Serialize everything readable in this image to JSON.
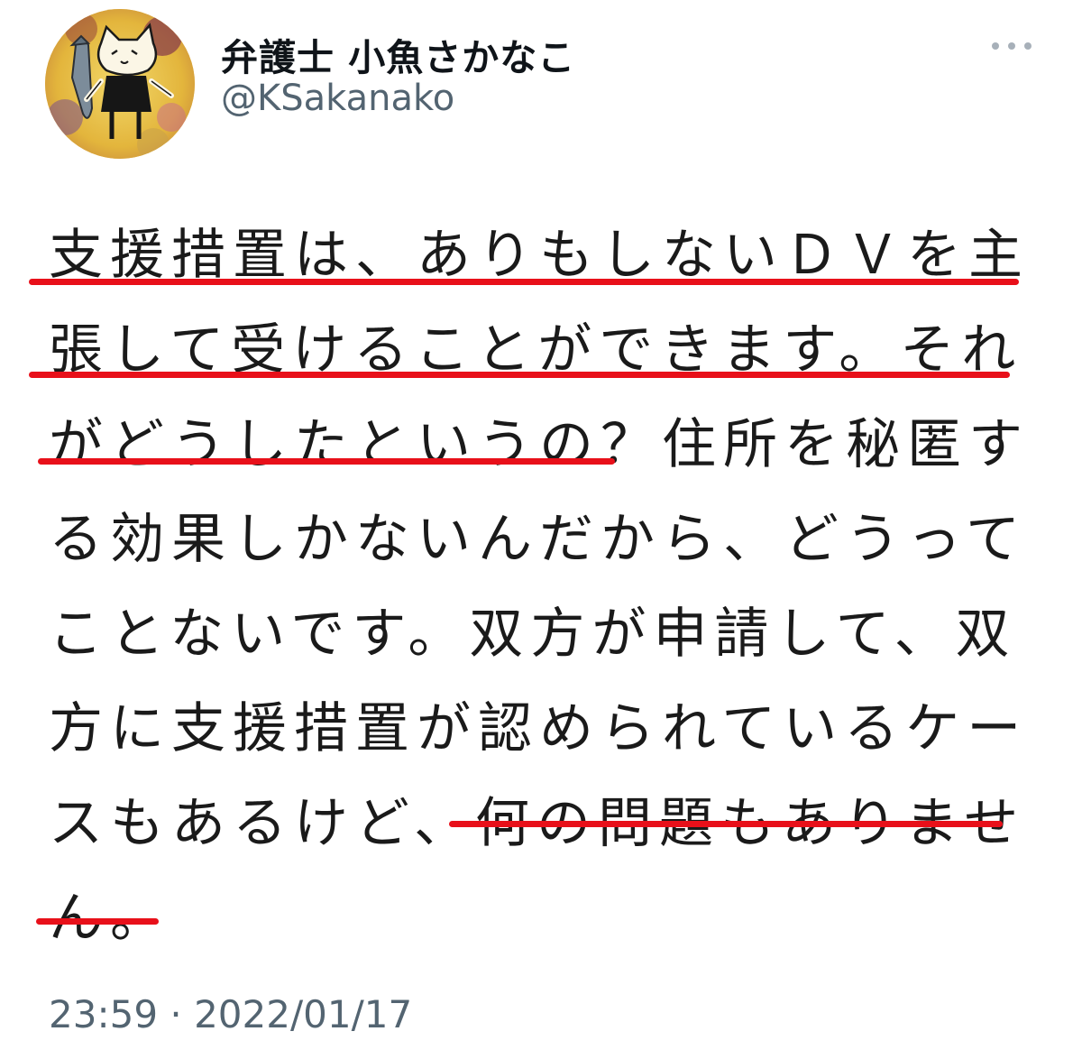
{
  "author": {
    "display_name": "弁護士 小魚さかなこ",
    "handle": "@KSakanako"
  },
  "tweet": {
    "lines": [
      "支援措置は、ありもしないＤＶを主",
      "張して受けることができます。それ",
      "がどうしたというの？住所を秘匿す",
      "る効果しかないんだから、どうって",
      "ことないです。双方が申請して、双",
      "方に支援措置が認められているケー",
      "スもあるけど、何の問題もありませ",
      "ん。"
    ],
    "underline_color": "#e8101a"
  },
  "timestamp": "23:59 · 2022/01/17",
  "colors": {
    "text": "#0f1419",
    "secondary": "#536471",
    "highlight": "#e8101a"
  },
  "icons": {
    "more": "more-horizontal-icon",
    "avatar": "cat-holding-fish-avatar"
  }
}
